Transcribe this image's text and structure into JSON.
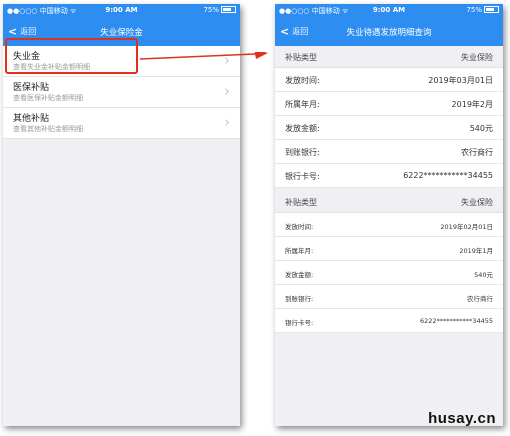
{
  "colors": {
    "accent": "#2d8df1",
    "highlight": "#e0311e"
  },
  "statusbar": {
    "carrier": "●●○○○ 中国移动 ᯤ",
    "time": "9:00 AM",
    "battery": "75%"
  },
  "left": {
    "back_label": "返回",
    "title": "失业保险金",
    "items": [
      {
        "title": "失业金",
        "subtitle": "查看失业金补贴金额明细"
      },
      {
        "title": "医保补贴",
        "subtitle": "查看医保补贴金额明细"
      },
      {
        "title": "其他补贴",
        "subtitle": "查看其他补贴金额明细"
      }
    ]
  },
  "right": {
    "back_label": "返回",
    "title": "失业待遇发放明细查询",
    "records": [
      {
        "type_label": "补贴类型",
        "type_value": "失业保险",
        "rows": [
          {
            "label": "发放时间:",
            "value": "2019年03月01日"
          },
          {
            "label": "所属年月:",
            "value": "2019年2月"
          },
          {
            "label": "发放金额:",
            "value": "540元"
          },
          {
            "label": "到账银行:",
            "value": "农行商行"
          },
          {
            "label": "银行卡号:",
            "value": "6222***********34455"
          }
        ]
      },
      {
        "type_label": "补贴类型",
        "type_value": "失业保险",
        "rows": [
          {
            "label": "发放时间:",
            "value": "2019年02月01日"
          },
          {
            "label": "所属年月:",
            "value": "2019年1月"
          },
          {
            "label": "发放金额:",
            "value": "540元"
          },
          {
            "label": "到账银行:",
            "value": "农行商行"
          },
          {
            "label": "银行卡号:",
            "value": "6222***********34455"
          }
        ]
      }
    ]
  },
  "watermark": "husay.cn"
}
